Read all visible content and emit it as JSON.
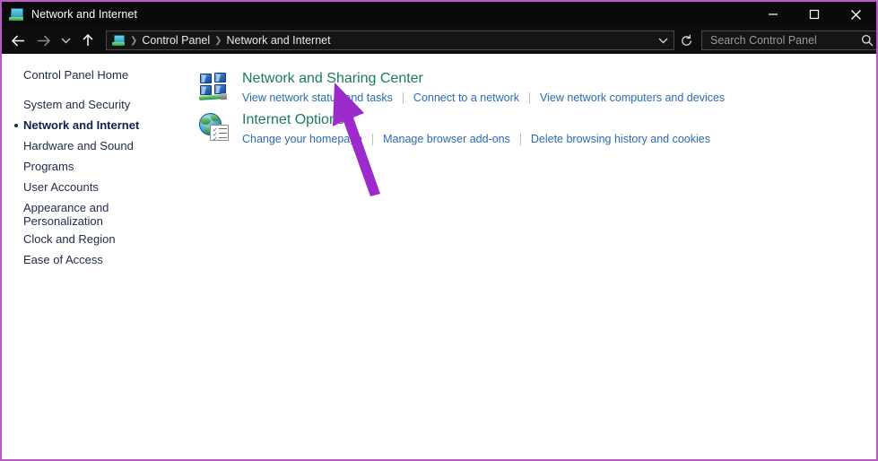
{
  "window": {
    "title": "Network and Internet",
    "title_icon": "control-panel-icon",
    "controls": {
      "minimize": "Minimize",
      "maximize": "Maximize",
      "close": "Close"
    }
  },
  "navbar": {
    "back": "Back",
    "forward": "Forward",
    "recent_locations": "Recent locations",
    "up": "Up",
    "refresh": "Refresh",
    "breadcrumb": [
      {
        "label": "Control Panel"
      },
      {
        "label": "Network and Internet"
      }
    ],
    "address_dropdown": "chevron-down-icon"
  },
  "search": {
    "placeholder": "Search Control Panel",
    "value": "",
    "icon": "search-icon"
  },
  "sidebar": {
    "home": "Control Panel Home",
    "items": [
      {
        "label": "System and Security",
        "selected": false
      },
      {
        "label": "Network and Internet",
        "selected": true
      },
      {
        "label": "Hardware and Sound",
        "selected": false
      },
      {
        "label": "Programs",
        "selected": false
      },
      {
        "label": "User Accounts",
        "selected": false
      },
      {
        "label": "Appearance and Personalization",
        "selected": false
      },
      {
        "label": "Clock and Region",
        "selected": false
      },
      {
        "label": "Ease of Access",
        "selected": false
      }
    ]
  },
  "main": {
    "categories": [
      {
        "icon": "network-sharing-center-icon",
        "heading": "Network and Sharing Center",
        "links": [
          "View network status and tasks",
          "Connect to a network",
          "View network computers and devices"
        ]
      },
      {
        "icon": "internet-options-icon",
        "heading": "Internet Options",
        "links": [
          "Change your homepage",
          "Manage browser add-ons",
          "Delete browsing history and cookies"
        ]
      }
    ]
  },
  "annotation": {
    "type": "arrow",
    "color": "#9C2BCB",
    "points_to": "View network status and tasks"
  },
  "colors": {
    "window_border": "#b95bc4",
    "titlebar_bg": "#0a0a0a",
    "navbar_bg": "#0d0d0d",
    "heading": "#1c7a5d",
    "link": "#2a6bb5",
    "sidebar_text": "#1f2a4a",
    "annotation": "#9C2BCB"
  }
}
